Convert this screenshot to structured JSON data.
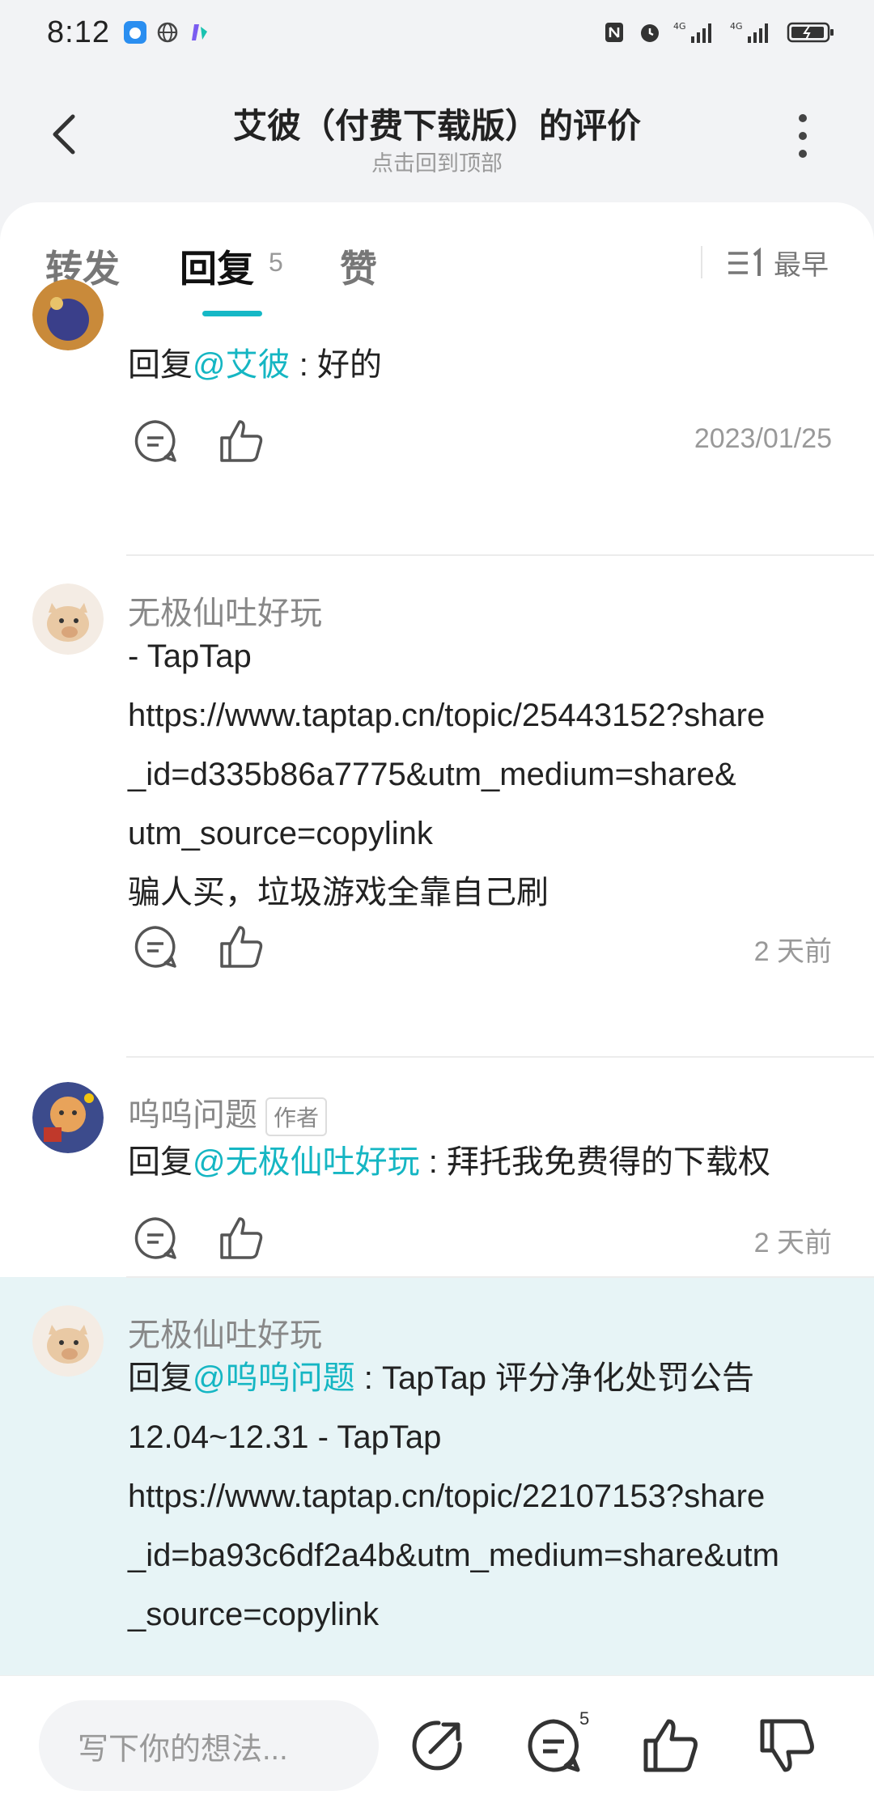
{
  "status_bar": {
    "time": "8:12"
  },
  "header": {
    "title": "艾彼（付费下载版）的评价",
    "subtitle": "点击回到顶部"
  },
  "tabs": {
    "repost": "转发",
    "reply": "回复",
    "reply_count": "5",
    "like": "赞",
    "sort_label": "最早"
  },
  "comments": [
    {
      "reply_prefix": "回复",
      "mention": "@艾彼",
      "text": " : 好的",
      "time": "2023/01/25"
    },
    {
      "name": "无极仙吐好玩",
      "lines": [
        "- TapTap",
        "https://www.taptap.cn/topic/25443152?share",
        "_id=d335b86a7775&utm_medium=share&",
        "utm_source=copylink",
        "骗人买，垃圾游戏全靠自己刷"
      ],
      "time": "2 天前"
    },
    {
      "name": "呜呜问题",
      "author_tag": "作者",
      "reply_prefix": "回复",
      "mention": "@无极仙吐好玩",
      "text": " : 拜托我免费得的下载权",
      "time": "2 天前"
    },
    {
      "name": "无极仙吐好玩",
      "reply_prefix": "回复",
      "mention": "@呜呜问题",
      "text": " : TapTap 评分净化处罚公告",
      "lines": [
        "12.04~12.31 - TapTap",
        "https://www.taptap.cn/topic/22107153?share",
        "_id=ba93c6df2a4b&utm_medium=share&utm",
        "_source=copylink"
      ]
    }
  ],
  "bottom_bar": {
    "input_placeholder": "写下你的想法...",
    "comment_badge": "5"
  },
  "colors": {
    "accent": "#15b6c3",
    "highlight_bg": "#e7f4f6"
  }
}
